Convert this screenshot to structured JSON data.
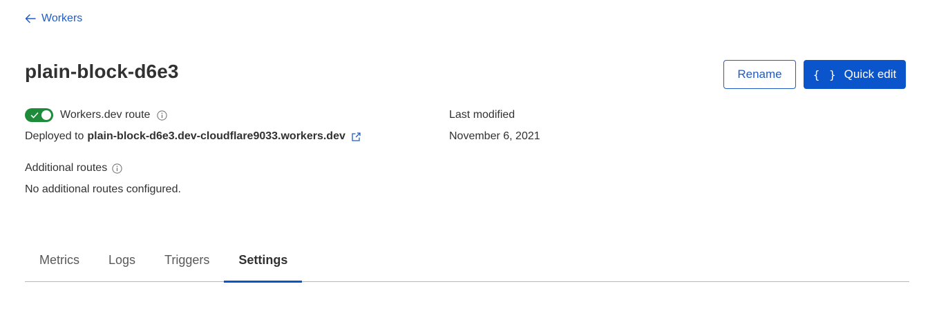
{
  "nav": {
    "back_label": "Workers"
  },
  "header": {
    "title": "plain-block-d6e3",
    "rename_label": "Rename",
    "quick_edit_braces": "{ }",
    "quick_edit_label": "Quick edit"
  },
  "route": {
    "toggle_on": true,
    "label": "Workers.dev route",
    "deployed_prefix": "Deployed to",
    "domain": "plain-block-d6e3.dev-cloudflare9033.workers.dev"
  },
  "additional_routes": {
    "label": "Additional routes",
    "value": "No additional routes configured."
  },
  "last_modified": {
    "label": "Last modified",
    "value": "November 6, 2021"
  },
  "tabs": [
    {
      "label": "Metrics",
      "active": false
    },
    {
      "label": "Logs",
      "active": false
    },
    {
      "label": "Triggers",
      "active": false
    },
    {
      "label": "Settings",
      "active": true
    }
  ],
  "colors": {
    "link": "#1f5bc4",
    "primary": "#0a54cc",
    "toggle_on": "#1e8b3a",
    "text": "#313131"
  },
  "icons": {
    "back": "arrow-left-icon",
    "info": "info-icon",
    "external": "external-link-icon",
    "toggle_check": "check-icon"
  }
}
